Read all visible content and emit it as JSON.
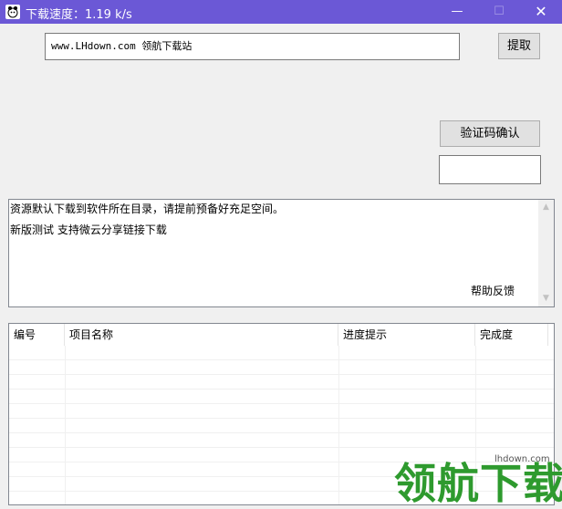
{
  "window": {
    "title": "下载速度：1.19 k/s",
    "controls": {
      "minimize": "—",
      "maximize": "☐",
      "close": "✕"
    }
  },
  "url_input": {
    "value": "www.LHdown.com 领航下载站"
  },
  "buttons": {
    "extract": "提取",
    "captcha_confirm": "验证码确认"
  },
  "captcha_input": {
    "value": ""
  },
  "log": {
    "lines": [
      "资源默认下载到软件所在目录，请提前预备好充足空间。",
      "新版测试 支持微云分享链接下载"
    ],
    "help_link": "帮助反馈"
  },
  "table": {
    "columns": [
      "编号",
      "项目名称",
      "进度提示",
      "完成度"
    ]
  },
  "watermark": {
    "url": "lhdown.com",
    "text": "领航下载"
  },
  "colors": {
    "titlebar": "#6b58d6",
    "watermark_green": "#2e9a2e"
  }
}
